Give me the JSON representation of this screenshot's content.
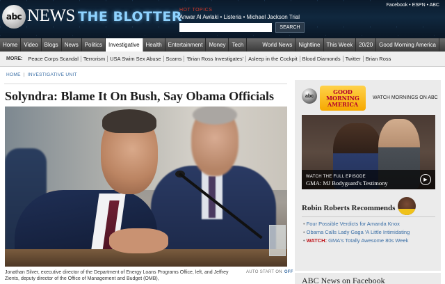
{
  "header": {
    "logo_text": "abc",
    "brand": "NEWS",
    "section_brand": "THE BLOTTER",
    "hot_topics_label": "HOT TOPICS",
    "hot_topics": "Anwar Al Awlaki • Listeria • Michael Jackson Trial",
    "search_placeholder": "",
    "search_button": "SEARCH",
    "top_links": "Facebook • ESPN • ABC"
  },
  "main_nav": {
    "items": [
      "Home",
      "Video",
      "Blogs",
      "News",
      "Politics",
      "Investigative",
      "Health",
      "Entertainment",
      "Money",
      "Tech"
    ],
    "active": "Investigative",
    "right_items": [
      "World News",
      "Nightline",
      "This Week",
      "20/20",
      "Good Morning America"
    ]
  },
  "sub_nav": {
    "label": "MORE:",
    "items": [
      "Peace Corps Scandal",
      "Terrorism",
      "USA Swim Sex Abuse",
      "Scams",
      "'Brian Ross Investigates'",
      "Asleep in the Cockpit",
      "Blood Diamonds",
      "Twitter",
      "Brian Ross"
    ]
  },
  "breadcrumb": [
    "HOME",
    "INVESTIGATIVE UNIT"
  ],
  "article": {
    "headline": "Solyndra: Blame It On Bush, Say Obama Officials",
    "caption": "Jonathan Silver, executive director of the Department of Energy Loans Programs Office, left, and Jeffrey Zients, deputy director of the Office of Management and Budget (OMB),",
    "autostart_label": "AUTO START ON",
    "autostart_off": "OFF"
  },
  "sidebar": {
    "gma_logo_line1": "GOOD",
    "gma_logo_line2": "MORNING",
    "gma_logo_line3": "AMERICA",
    "gma_abc": "abc",
    "gma_cta": "WATCH MORNINGS ON ABC",
    "video_label": "WATCH THE FULL EPISODE",
    "video_title": "GMA: MJ Bodyguard's Testimony",
    "play_icon": "▶",
    "rr_title": "Robin Roberts Recommends",
    "rr_items": [
      {
        "prefix": "",
        "text": "Four Possible Verdicts for Amanda Knox"
      },
      {
        "prefix": "",
        "text": "Obama Calls Lady Gaga 'A Little Intimidating"
      },
      {
        "prefix": "WATCH:",
        "text": "GMA's Totally Awesome 80s Week"
      }
    ],
    "fb_title": "ABC News on Facebook"
  },
  "colors": {
    "link": "#3a6ea5",
    "accent_red": "#c0151b",
    "nav_dark": "#3a3a3a"
  }
}
